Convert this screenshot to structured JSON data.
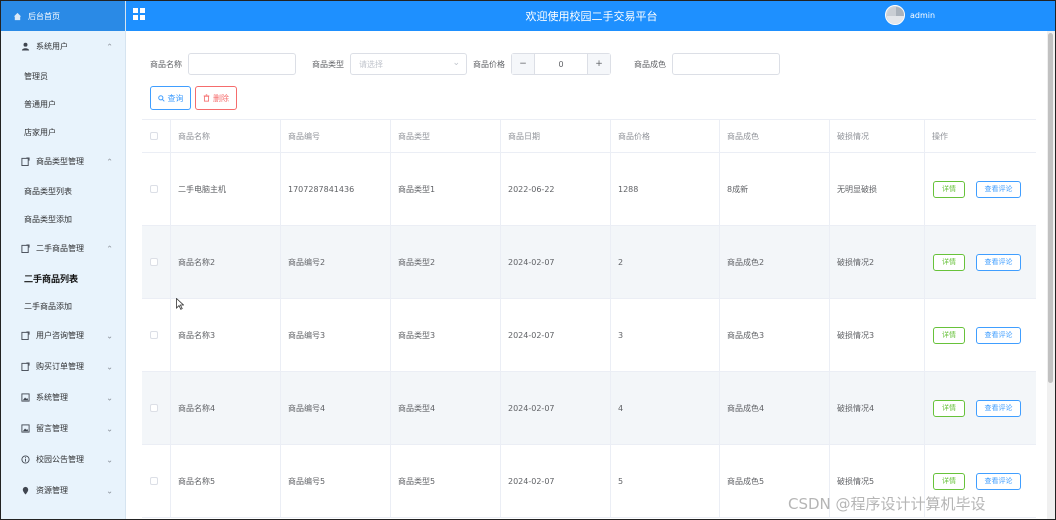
{
  "sidebar": {
    "home": "后台首页",
    "items": [
      {
        "label": "系统用户",
        "type": "group",
        "expanded": true,
        "icon": "user-icon"
      },
      {
        "label": "管理员",
        "type": "child"
      },
      {
        "label": "普通用户",
        "type": "child"
      },
      {
        "label": "店家用户",
        "type": "child"
      },
      {
        "label": "商品类型管理",
        "type": "group",
        "expanded": true,
        "icon": "doc-icon"
      },
      {
        "label": "商品类型列表",
        "type": "child"
      },
      {
        "label": "商品类型添加",
        "type": "child"
      },
      {
        "label": "二手商品管理",
        "type": "group",
        "expanded": true,
        "icon": "doc-icon"
      },
      {
        "label": "二手商品列表",
        "type": "child",
        "active": true
      },
      {
        "label": "二手商品添加",
        "type": "child"
      },
      {
        "label": "用户咨询管理",
        "type": "group",
        "expanded": false,
        "icon": "doc-icon"
      },
      {
        "label": "购买订单管理",
        "type": "group",
        "expanded": false,
        "icon": "doc-icon"
      },
      {
        "label": "系统管理",
        "type": "group",
        "expanded": false,
        "icon": "image-icon"
      },
      {
        "label": "留言管理",
        "type": "group",
        "expanded": false,
        "icon": "image-icon"
      },
      {
        "label": "校园公告管理",
        "type": "group",
        "expanded": false,
        "icon": "info-icon"
      },
      {
        "label": "资源管理",
        "type": "group",
        "expanded": false,
        "icon": "location-icon"
      }
    ]
  },
  "header": {
    "title": "欢迎使用校园二手交易平台",
    "user": "admin"
  },
  "search": {
    "name_label": "商品名称",
    "name_value": "",
    "type_label": "商品类型",
    "type_placeholder": "请选择",
    "price_label": "商品价格",
    "price_value": "0",
    "condition_label": "商品成色",
    "condition_value": ""
  },
  "buttons": {
    "query": "查询",
    "delete": "删除"
  },
  "table": {
    "headers": [
      "商品名称",
      "商品编号",
      "商品类型",
      "商品日期",
      "商品价格",
      "商品成色",
      "破损情况",
      "操作"
    ],
    "rows": [
      {
        "name": "二手电脑主机",
        "code": "1707287841436",
        "type": "商品类型1",
        "date": "2022-06-22",
        "price": "1288",
        "condition": "8成新",
        "damage": "无明显破损",
        "detail": "详情",
        "review": "查看评论"
      },
      {
        "name": "商品名称2",
        "code": "商品编号2",
        "type": "商品类型2",
        "date": "2024-02-07",
        "price": "2",
        "condition": "商品成色2",
        "damage": "破损情况2",
        "detail": "详情",
        "review": "查看评论"
      },
      {
        "name": "商品名称3",
        "code": "商品编号3",
        "type": "商品类型3",
        "date": "2024-02-07",
        "price": "3",
        "condition": "商品成色3",
        "damage": "破损情况3",
        "detail": "详情",
        "review": "查看评论"
      },
      {
        "name": "商品名称4",
        "code": "商品编号4",
        "type": "商品类型4",
        "date": "2024-02-07",
        "price": "4",
        "condition": "商品成色4",
        "damage": "破损情况4",
        "detail": "详情",
        "review": "查看评论"
      },
      {
        "name": "商品名称5",
        "code": "商品编号5",
        "type": "商品类型5",
        "date": "2024-02-07",
        "price": "5",
        "condition": "商品成色5",
        "damage": "破损情况5",
        "detail": "详情",
        "review": "查看评论"
      }
    ]
  },
  "watermark": "CSDN @程序设计计算机毕设",
  "colors": {
    "header": "#1e90ff",
    "sidebar": "#e8f3fc",
    "primary": "#409eff",
    "danger": "#f56c6c",
    "success": "#67c23a"
  }
}
